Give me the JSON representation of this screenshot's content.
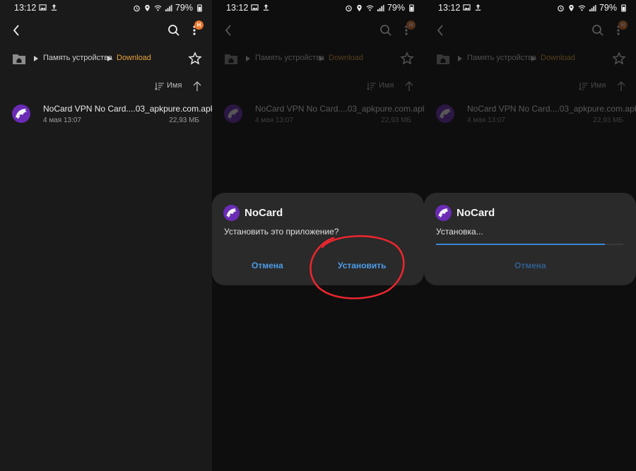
{
  "statusbar": {
    "time": "13:12",
    "battery": "79%"
  },
  "toolbar": {
    "badge": "Н"
  },
  "breadcrumb": {
    "storage": "Память устройства",
    "folder": "Download"
  },
  "sort": {
    "label": "Имя"
  },
  "file": {
    "name": "NoCard VPN No Card....03_apkpure.com.apk",
    "date": "4 мая 13:07",
    "size": "22,93 МБ"
  },
  "install_dialog": {
    "app_name": "NoCard",
    "message": "Установить это приложение?",
    "cancel_label": "Отмена",
    "install_label": "Установить"
  },
  "progress_dialog": {
    "app_name": "NoCard",
    "message": "Установка...",
    "cancel_label": "Отмена",
    "progress": 0.9
  },
  "colors": {
    "accent_folder": "#e8a33a",
    "button_blue": "#4e9de8",
    "app_icon": "#6a2bb5",
    "badge": "#e8742a",
    "annotation": "#e8262e"
  }
}
